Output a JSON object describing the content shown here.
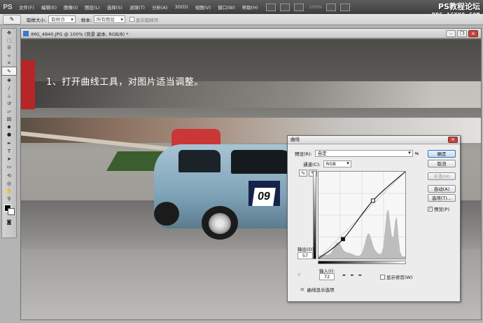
{
  "app": {
    "logo": "PS",
    "menus": [
      "文件(F)",
      "编辑(E)",
      "图像(I)",
      "图层(L)",
      "选择(S)",
      "滤镜(T)",
      "分析(A)",
      "3D(D)",
      "视图(V)",
      "窗口(W)",
      "帮助(H)"
    ],
    "zoom": "100%",
    "watermark_line1": "PS教程论坛",
    "watermark_line2": "BBS.16XX8.COM"
  },
  "options": {
    "sample_size_label": "取样大小:",
    "sample_size_value": "取样点",
    "sample_label": "样本:",
    "sample_value": "所有图层",
    "show_ring_label": "显示取样环"
  },
  "document": {
    "title": "IMG_4840.JPG @ 100% (背景 副本, RGB/8) *",
    "annotation": "1、打开曲线工具，对图片适当调整。",
    "car_number": "09"
  },
  "curves": {
    "title": "曲线",
    "preset_label": "预设(R):",
    "preset_value": "自定",
    "channel_label": "通道(C):",
    "channel_value": "RGB",
    "output_label": "输出(O):",
    "output_value": "57",
    "input_label": "输入(I):",
    "input_value": "72",
    "show_clipping_label": "显示修剪(W)",
    "display_options_label": "曲线显示选项",
    "buttons": {
      "ok": "确定",
      "cancel": "取消",
      "smooth": "平滑(M)",
      "auto": "自动(A)",
      "options": "选项(T)..."
    },
    "preview_label": "预览(P)",
    "preview_checked": true,
    "curve_points": [
      [
        0,
        0
      ],
      [
        72,
        57
      ],
      [
        160,
        170
      ],
      [
        255,
        255
      ]
    ],
    "histogram_color": "#bdbdbd"
  }
}
